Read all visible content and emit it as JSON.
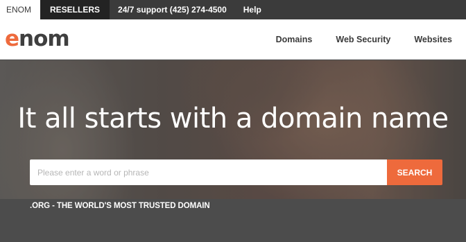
{
  "topbar": {
    "items": [
      {
        "label": "ENOM"
      },
      {
        "label": "RESELLERS"
      },
      {
        "label": "24/7 support (425) 274-4500"
      },
      {
        "label": "Help"
      }
    ]
  },
  "header": {
    "logo": {
      "initial": "e",
      "rest": "nom"
    },
    "nav": [
      {
        "label": "Domains"
      },
      {
        "label": "Web Security"
      },
      {
        "label": "Websites"
      }
    ]
  },
  "hero": {
    "title": "It all starts with a domain name",
    "search": {
      "placeholder": "Please enter a word or phrase",
      "value": "",
      "button_label": "SEARCH"
    }
  },
  "promo": {
    "text": ".ORG - THE WORLD'S MOST TRUSTED DOMAIN"
  },
  "colors": {
    "accent": "#ee6a3c",
    "topbar_bg": "#3b3b3b",
    "promo_bg": "#4c4c4c"
  }
}
